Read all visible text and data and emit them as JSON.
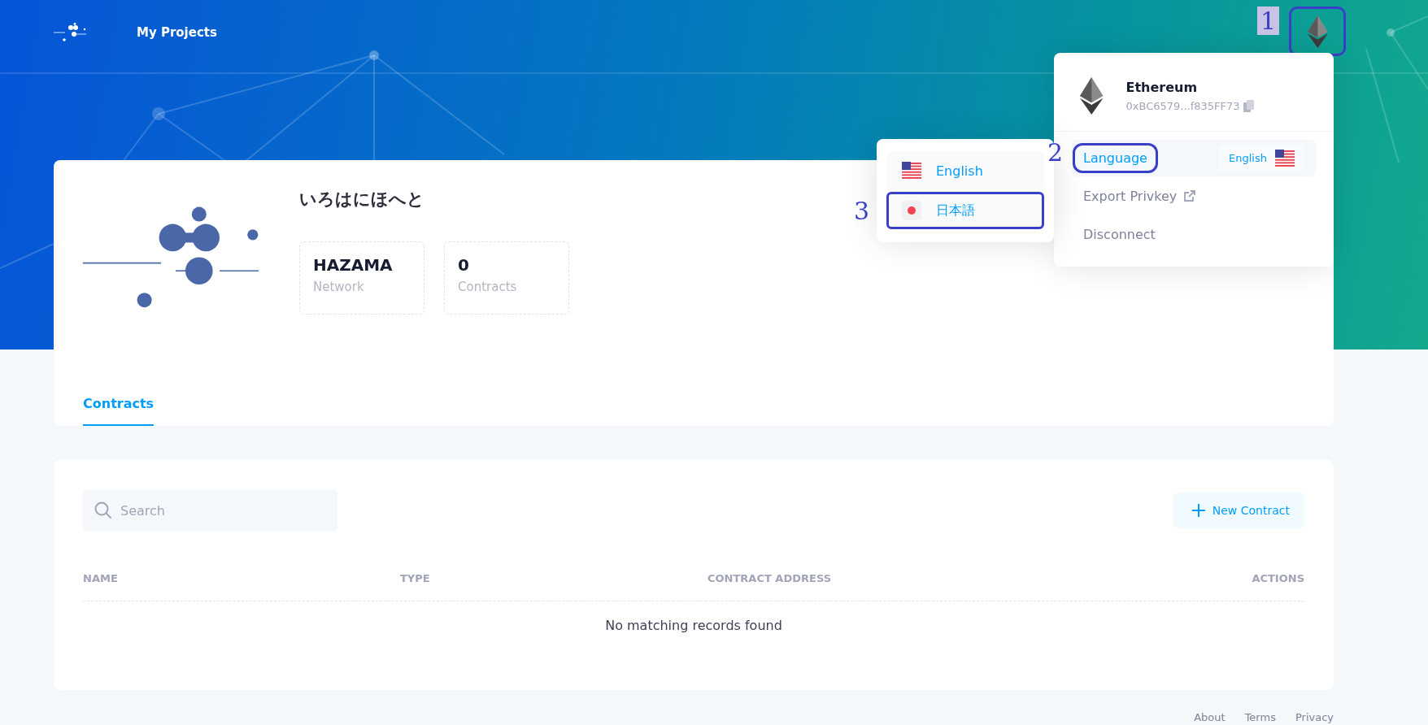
{
  "topbar": {
    "nav_label": "My Projects",
    "wallet_button": {
      "outlined": true,
      "callout": "1"
    }
  },
  "project": {
    "title": "いろはにほへと",
    "stats": [
      {
        "value": "HAZAMA",
        "label": "Network"
      },
      {
        "value": "0",
        "label": "Contracts"
      }
    ],
    "tabs": [
      {
        "label": "Contracts",
        "selected": true
      }
    ]
  },
  "contracts": {
    "search": {
      "placeholder": "Search"
    },
    "new_button": "New Contract",
    "columns": [
      "NAME",
      "TYPE",
      "CONTRACT ADDRESS",
      "ACTIONS"
    ],
    "empty_message": "No matching records found"
  },
  "account_menu": {
    "network": "Ethereum",
    "address": "0xBC6579...f835FF73",
    "items": [
      {
        "kind": "language",
        "label": "Language",
        "value": "English",
        "selected": true,
        "outlined": true,
        "callout": "2"
      },
      {
        "kind": "external",
        "label": "Export Privkey",
        "selected": false,
        "outlined": false
      },
      {
        "kind": "plain",
        "label": "Disconnect",
        "selected": false,
        "outlined": false
      }
    ]
  },
  "language_menu": {
    "items": [
      {
        "kind": "us",
        "label": "English",
        "outlined": false
      },
      {
        "kind": "jp",
        "label": "日本語",
        "outlined": true,
        "callout": "3"
      }
    ]
  },
  "footer": {
    "links": [
      "About",
      "Terms",
      "Privacy"
    ]
  }
}
